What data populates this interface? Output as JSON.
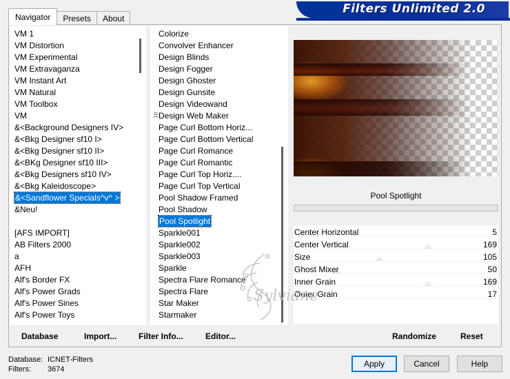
{
  "banner": {
    "title": "Filters Unlimited 2.0"
  },
  "tabs": [
    {
      "label": "Navigator",
      "active": true
    },
    {
      "label": "Presets",
      "active": false
    },
    {
      "label": "About",
      "active": false
    }
  ],
  "categories": {
    "items": [
      "VM 1",
      "VM Distortion",
      "VM Experimental",
      "VM Extravaganza",
      "VM Instant Art",
      "VM Natural",
      "VM Toolbox",
      "VM",
      "&<Background Designers IV>",
      "&<Bkg Designer sf10 I>",
      "&<Bkg Designer sf10 II>",
      "&<BKg Designer sf10 III>",
      "&<Bkg Designers sf10 IV>",
      "&<Bkg Kaleidoscope>",
      "&<Sandflower Specials^v^ >",
      "&Neu!",
      "",
      "[AFS IMPORT]",
      "AB Filters 2000",
      "a",
      "AFH",
      "Alf's Border FX",
      "Alf's Power Grads",
      "Alf's Power Sines",
      "Alf's Power Toys"
    ],
    "selected_index": 14
  },
  "filters": {
    "items": [
      "Colorize",
      "Convolver Enhancer",
      "Design Blinds",
      "Design Fogger",
      "Design Ghoster",
      "Design Gunsite",
      "Design Videowand",
      "Design Web Maker",
      "Page Curl Bottom Horiz...",
      "Page Curl Bottom Vertical",
      "Page Curl Romance",
      "Page Curl Romantic",
      "Page Curl Top Horiz....",
      "Page Curl Top Vertical",
      "Pool Shadow Framed",
      "Pool Shadow",
      "Pool Spotlight",
      "Sparkle001",
      "Sparkle002",
      "Sparkle003",
      "Sparkle",
      "Spectra Flare Romance",
      "Spectra Flare",
      "Star Maker",
      "Starmaker"
    ],
    "selected_index": 16
  },
  "preview": {
    "filter_name": "Pool Spotlight",
    "progress": 0
  },
  "params": [
    {
      "label": "Center Horizontal",
      "value": "5",
      "level": 5
    },
    {
      "label": "Center Vertical",
      "value": "169",
      "level": 169
    },
    {
      "label": "Size",
      "value": "105",
      "level": 105
    },
    {
      "label": "Ghost Mixer",
      "value": "50",
      "level": 50
    },
    {
      "label": "Inner Grain",
      "value": "169",
      "level": 169
    },
    {
      "label": "Outer Grain",
      "value": "17",
      "level": 17
    }
  ],
  "param_max": 255,
  "buttons": {
    "database": "Database",
    "import": "Import...",
    "filter_info": "Filter Info...",
    "editor": "Editor...",
    "randomize": "Randomize",
    "reset": "Reset",
    "apply": "Apply",
    "cancel": "Cancel",
    "help": "Help"
  },
  "status": {
    "database_label": "Database:",
    "database_value": "ICNET-Filters",
    "filters_label": "Filters:",
    "filters_value": "3674"
  },
  "watermark": {
    "text": "Sylviane"
  },
  "colors": {
    "banner": "#0b2e99",
    "selection": "#0078d7",
    "progress": "#06b025"
  }
}
